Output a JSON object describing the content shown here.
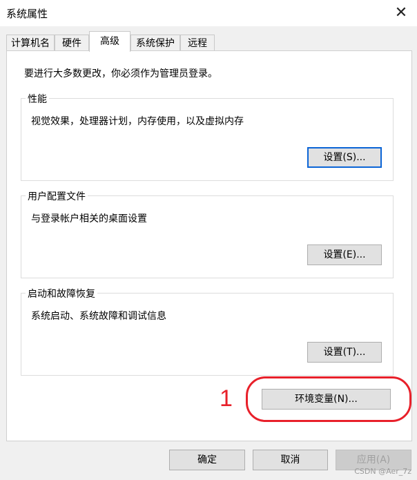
{
  "window": {
    "title": "系统属性"
  },
  "tabs": [
    {
      "label": "计算机名"
    },
    {
      "label": "硬件"
    },
    {
      "label": "高级"
    },
    {
      "label": "系统保护"
    },
    {
      "label": "远程"
    }
  ],
  "notice": "要进行大多数更改，你必须作为管理员登录。",
  "performance": {
    "title": "性能",
    "desc": "视觉效果，处理器计划，内存使用，以及虚拟内存",
    "button": "设置(S)..."
  },
  "profiles": {
    "title": "用户配置文件",
    "desc": "与登录帐户相关的桌面设置",
    "button": "设置(E)..."
  },
  "startup": {
    "title": "启动和故障恢复",
    "desc": "系统启动、系统故障和调试信息",
    "button": "设置(T)..."
  },
  "env_button": "环境变量(N)...",
  "annotation": {
    "number": "1",
    "color": "#e8202a"
  },
  "footer": {
    "ok": "确定",
    "cancel": "取消",
    "apply": "应用(A)"
  },
  "watermark": "CSDN @Aer_7z"
}
